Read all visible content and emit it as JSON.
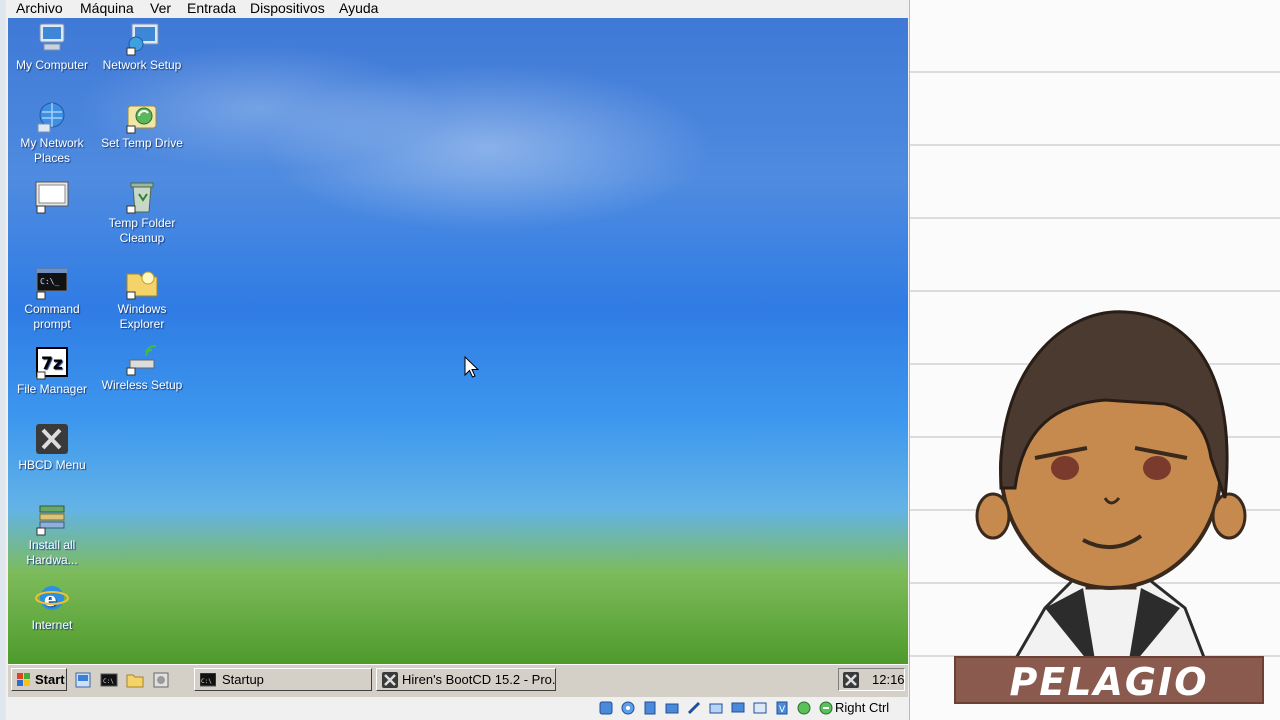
{
  "menubar": {
    "items": [
      {
        "label": "Archivo"
      },
      {
        "label": "Máquina"
      },
      {
        "label": "Ver"
      },
      {
        "label": "Entrada"
      },
      {
        "label": "Dispositivos"
      },
      {
        "label": "Ayuda"
      }
    ]
  },
  "desktop": {
    "icons": [
      {
        "label": "My Computer",
        "icon": "computer-icon"
      },
      {
        "label": "Network Setup",
        "icon": "network-setup-icon"
      },
      {
        "label": "My Network Places",
        "icon": "network-places-icon"
      },
      {
        "label": "Set Temp Drive",
        "icon": "temp-drive-icon"
      },
      {
        "label": "Temp Folder Cleanup",
        "icon": "recycle-bin-icon"
      },
      {
        "label": "Command prompt",
        "icon": "command-prompt-icon"
      },
      {
        "label": "Windows Explorer",
        "icon": "folder-icon"
      },
      {
        "label": "File Manager",
        "icon": "7zip-icon"
      },
      {
        "label": "Wireless Setup",
        "icon": "wireless-icon"
      },
      {
        "label": "HBCD Menu",
        "icon": "tools-icon"
      },
      {
        "label": "Install all Hardwa...",
        "icon": "hardware-icon"
      },
      {
        "label": "Internet",
        "icon": "ie-icon"
      }
    ]
  },
  "taskbar": {
    "start_label": "Start",
    "windows": [
      {
        "label": "Startup",
        "icon": "console-icon"
      },
      {
        "label": "Hiren's BootCD 15.2 - Pro...",
        "icon": "tools-icon"
      }
    ],
    "clock": "12:16"
  },
  "statusbar": {
    "host_key": "Right Ctrl"
  },
  "overlay": {
    "banner_text": "PELAGIO"
  }
}
